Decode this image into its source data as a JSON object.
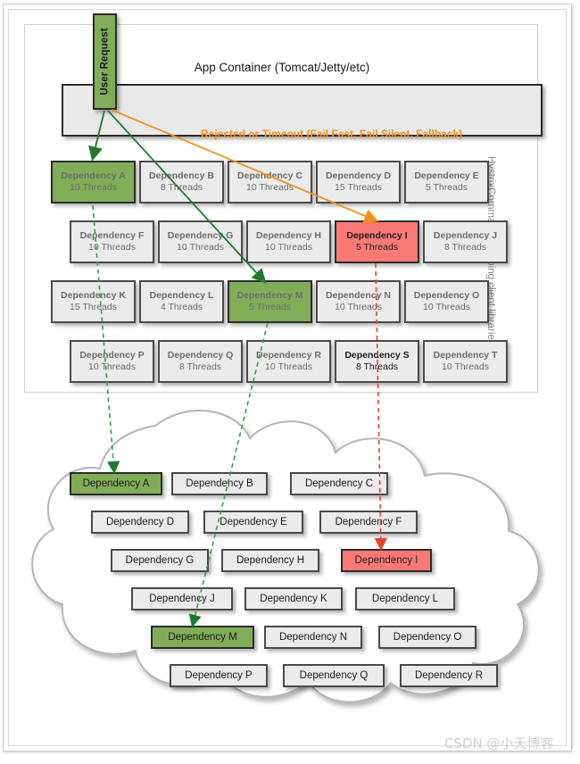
{
  "app_container": {
    "title": "App Container (Tomcat/Jetty/etc)",
    "side_label": "HystrixCommand wrapping client libraries"
  },
  "user_request": {
    "label": "User Request"
  },
  "rejected_label": "Rejected or Timeout (Fail Fast, Fail Silent, Fallback)",
  "thread_pools": [
    {
      "name": "Dependency A",
      "threads": "10 Threads",
      "state": "green"
    },
    {
      "name": "Dependency B",
      "threads": "8 Threads",
      "state": "normal"
    },
    {
      "name": "Dependency C",
      "threads": "10 Threads",
      "state": "normal"
    },
    {
      "name": "Dependency D",
      "threads": "15 Threads",
      "state": "normal"
    },
    {
      "name": "Dependency E",
      "threads": "5 Threads",
      "state": "normal"
    },
    {
      "name": "Dependency F",
      "threads": "10 Threads",
      "state": "normal"
    },
    {
      "name": "Dependency G",
      "threads": "10 Threads",
      "state": "normal"
    },
    {
      "name": "Dependency H",
      "threads": "10 Threads",
      "state": "normal"
    },
    {
      "name": "Dependency I",
      "threads": "5 Threads",
      "state": "red"
    },
    {
      "name": "Dependency J",
      "threads": "8 Threads",
      "state": "normal"
    },
    {
      "name": "Dependency K",
      "threads": "15 Threads",
      "state": "normal"
    },
    {
      "name": "Dependency L",
      "threads": "4 Threads",
      "state": "normal"
    },
    {
      "name": "Dependency M",
      "threads": "5 Threads",
      "state": "green"
    },
    {
      "name": "Dependency N",
      "threads": "10 Threads",
      "state": "normal"
    },
    {
      "name": "Dependency O",
      "threads": "10 Threads",
      "state": "normal"
    },
    {
      "name": "Dependency P",
      "threads": "10 Threads",
      "state": "normal"
    },
    {
      "name": "Dependency Q",
      "threads": "8 Threads",
      "state": "normal"
    },
    {
      "name": "Dependency R",
      "threads": "10 Threads",
      "state": "normal"
    },
    {
      "name": "Dependency S",
      "threads": "8 Threads",
      "state": "highlight"
    },
    {
      "name": "Dependency T",
      "threads": "10 Threads",
      "state": "normal"
    }
  ],
  "cloud_services": [
    {
      "name": "Dependency A",
      "state": "green"
    },
    {
      "name": "Dependency B",
      "state": "normal"
    },
    {
      "name": "Dependency C",
      "state": "normal"
    },
    {
      "name": "Dependency D",
      "state": "normal"
    },
    {
      "name": "Dependency E",
      "state": "normal"
    },
    {
      "name": "Dependency F",
      "state": "normal"
    },
    {
      "name": "Dependency G",
      "state": "normal"
    },
    {
      "name": "Dependency H",
      "state": "normal"
    },
    {
      "name": "Dependency I",
      "state": "red"
    },
    {
      "name": "Dependency J",
      "state": "normal"
    },
    {
      "name": "Dependency K",
      "state": "normal"
    },
    {
      "name": "Dependency L",
      "state": "normal"
    },
    {
      "name": "Dependency M",
      "state": "green"
    },
    {
      "name": "Dependency N",
      "state": "normal"
    },
    {
      "name": "Dependency O",
      "state": "normal"
    },
    {
      "name": "Dependency P",
      "state": "normal"
    },
    {
      "name": "Dependency Q",
      "state": "normal"
    },
    {
      "name": "Dependency R",
      "state": "normal"
    }
  ],
  "colors": {
    "green": "#81ad58",
    "red": "#fb7a75",
    "orange": "#f59018",
    "box_gray": "#ebebeb",
    "panel_gray": "#e9e9e9",
    "arrow_green": "#1d7a2e",
    "arrow_red": "#e8422e"
  },
  "watermark": "CSDN @小天博客"
}
